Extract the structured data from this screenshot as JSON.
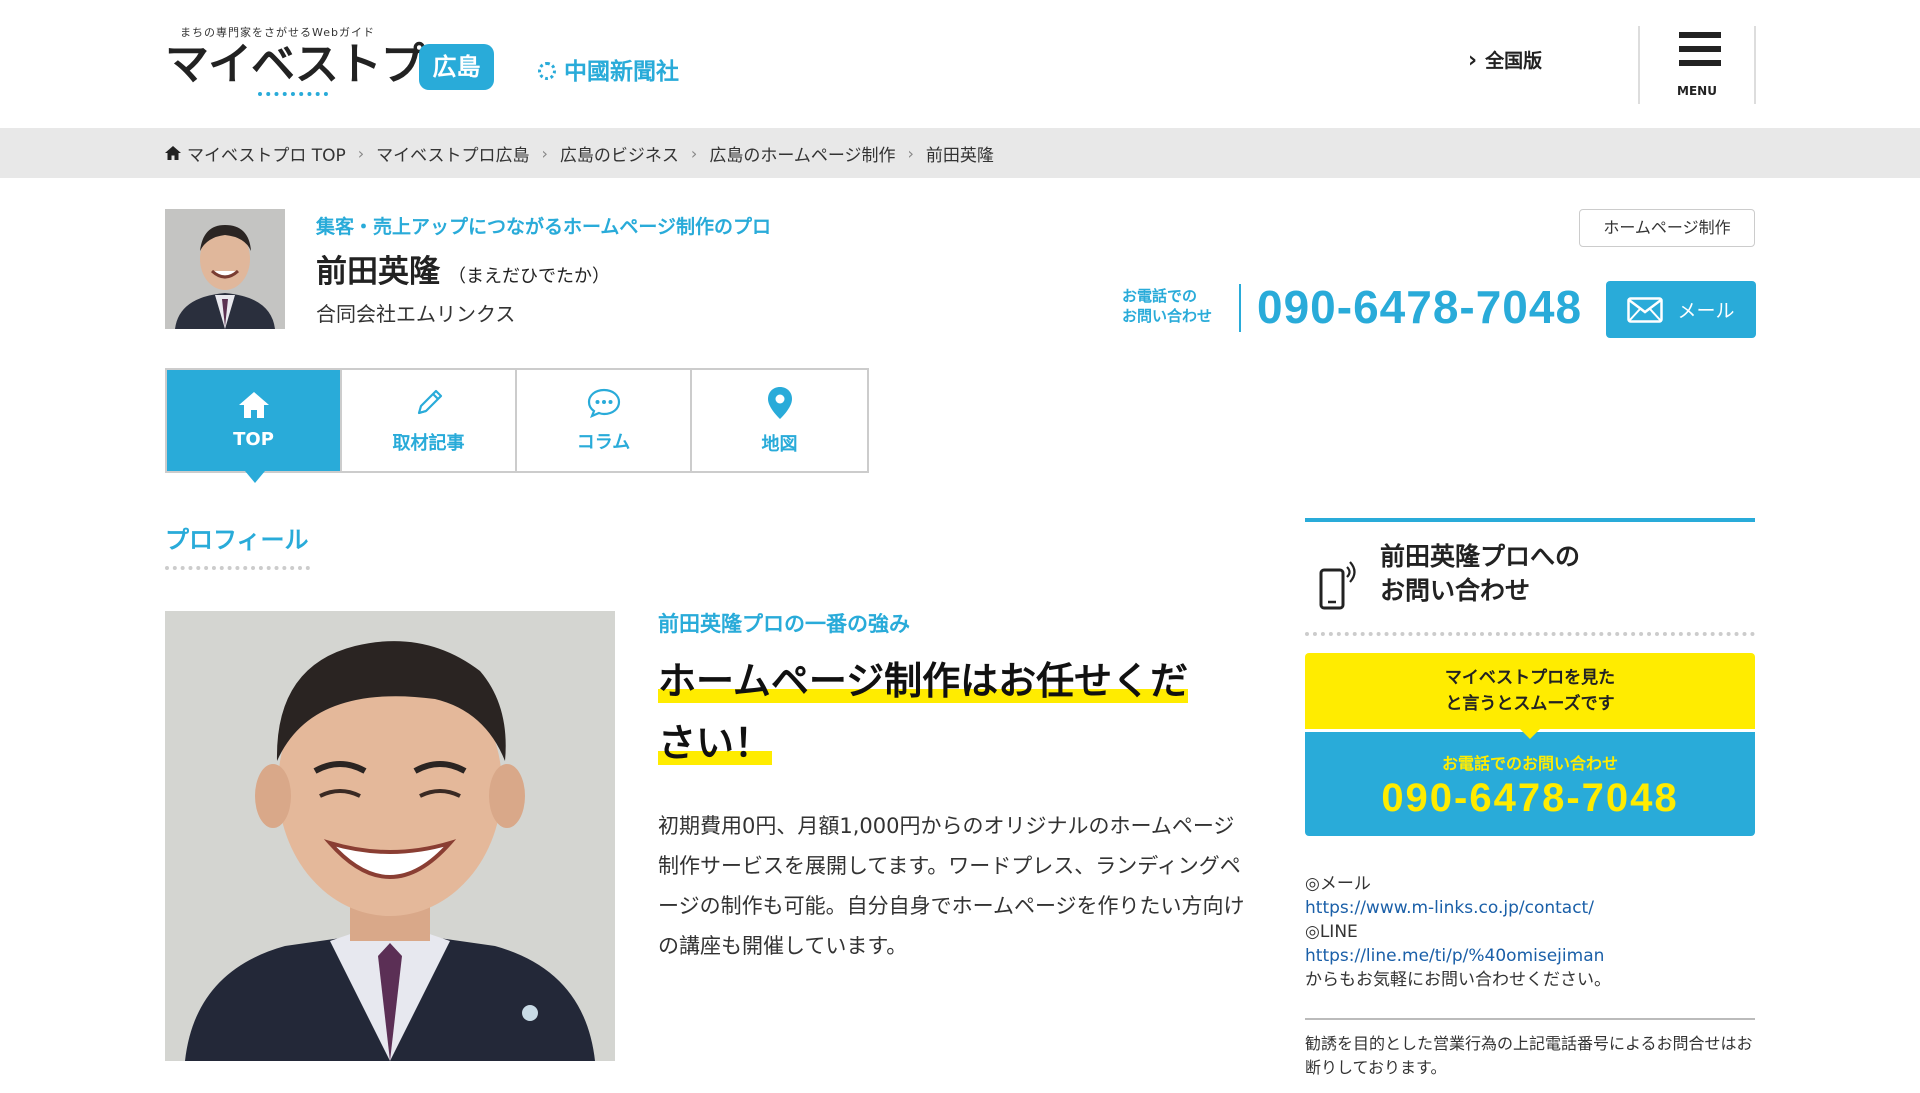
{
  "header": {
    "logo_tagline": "まちの専門家をさがせるWebガイド",
    "logo_main": "マイベストプロ",
    "logo_region": "広島",
    "partner": "中國新聞社",
    "national_link": "全国版",
    "menu_label": "MENU"
  },
  "breadcrumb": {
    "items": [
      "マイベストプロ TOP",
      "マイベストプロ広島",
      "広島のビジネス",
      "広島のホームページ制作",
      "前田英隆"
    ]
  },
  "profile": {
    "catch": "集客・売上アップにつながるホームページ制作のプロ",
    "name": "前田英隆",
    "kana": "（まえだひでたか）",
    "company": "合同会社エムリンクス",
    "category": "ホームページ制作",
    "phone_label_line1": "お電話での",
    "phone_label_line2": "お問い合わせ",
    "phone": "090-6478-7048",
    "mail_label": "メール"
  },
  "tabs": [
    {
      "label": "TOP",
      "icon": "home-icon",
      "active": true
    },
    {
      "label": "取材記事",
      "icon": "pencil-icon",
      "active": false
    },
    {
      "label": "コラム",
      "icon": "speech-bubble-icon",
      "active": false
    },
    {
      "label": "地図",
      "icon": "map-pin-icon",
      "active": false
    }
  ],
  "main": {
    "section_title": "プロフィール",
    "strength_label": "前田英隆プロの一番の強み",
    "headline_line1": "ホームページ制作はお任せくだ",
    "headline_line2": "さい！",
    "body": "初期費用0円、月額1,000円からのオリジナルのホームページ制作サービスを展開してます。ワードプレス、ランディングページの制作も可能。自分自身でホームページを作りたい方向けの講座も開催しています。"
  },
  "sidebar": {
    "title_line1": "前田英隆プロへの",
    "title_line2": "お問い合わせ",
    "yellow_line1": "マイベストプロを見た",
    "yellow_line2": "と言うとスムーズです",
    "phone_label": "お電話でのお問い合わせ",
    "phone": "090-6478-7048",
    "contact_mail_label": "◎メール",
    "contact_mail_url": "https://www.m-links.co.jp/contact/",
    "contact_line_label": "◎LINE",
    "contact_line_url": "https://line.me/ti/p/%40omisejiman",
    "contact_footer": "からもお気軽にお問い合わせください。",
    "notice": "勧誘を目的とした営業行為の上記電話番号によるお問合せはお断りしております。"
  },
  "colors": {
    "accent": "#29abd9",
    "highlight": "#ffec00",
    "breadcrumb_bg": "#e8e8e8"
  }
}
